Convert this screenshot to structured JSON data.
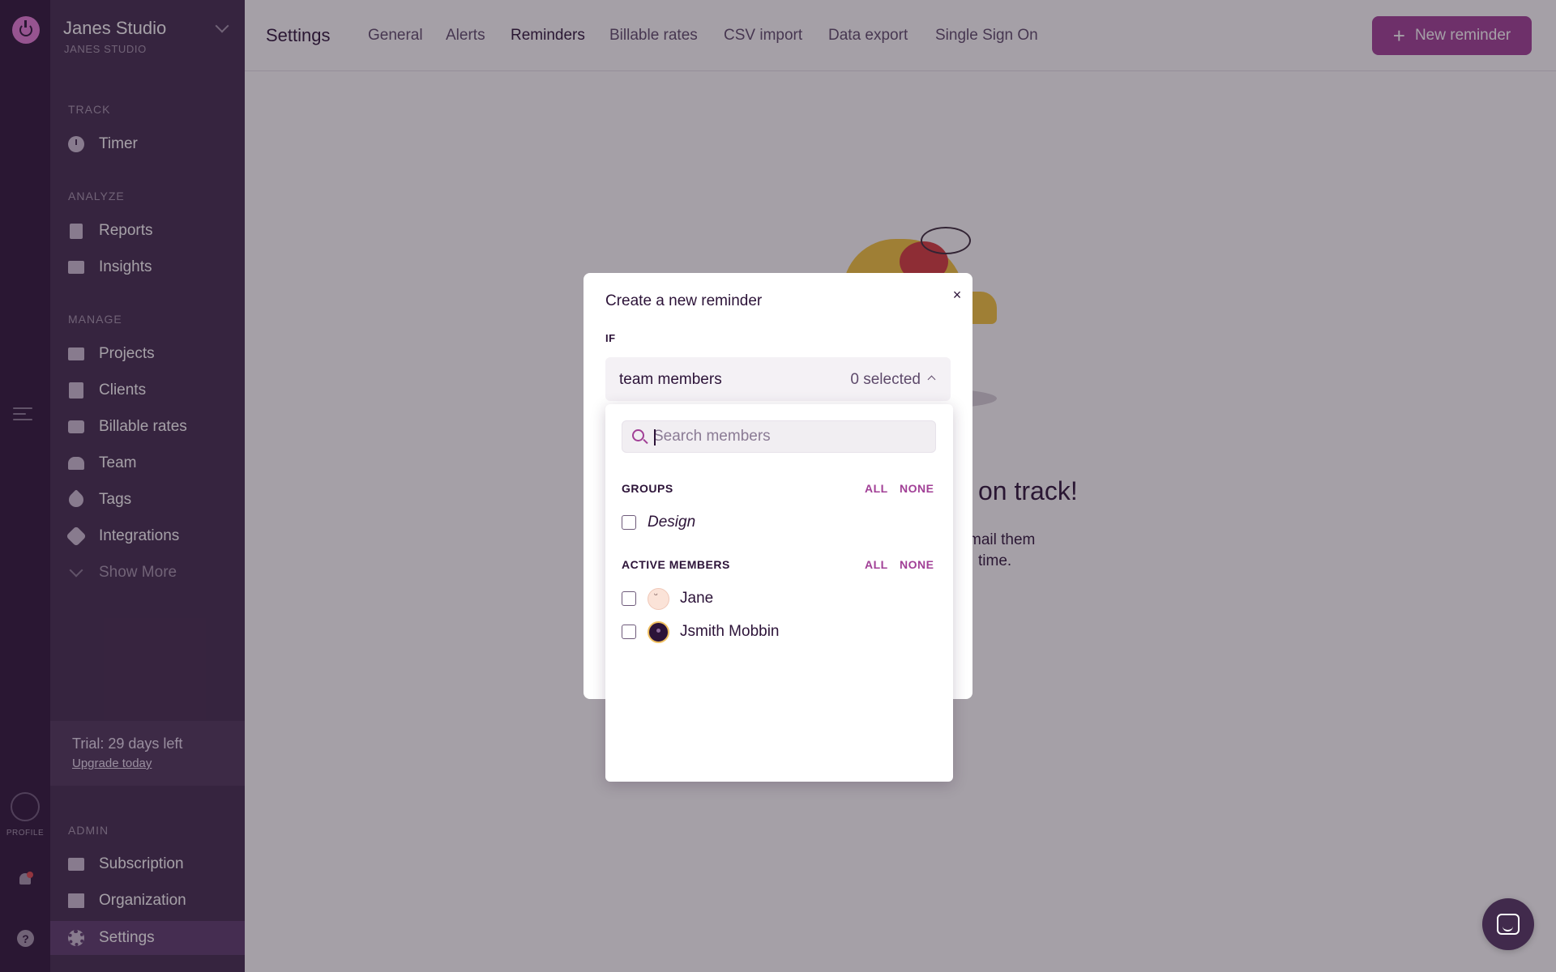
{
  "workspace": {
    "name": "Janes Studio",
    "subtitle": "JANES STUDIO"
  },
  "rail": {
    "profile_label": "PROFILE",
    "help": "?"
  },
  "sidebar": {
    "sections": {
      "track": "TRACK",
      "analyze": "ANALYZE",
      "manage": "MANAGE",
      "admin": "ADMIN"
    },
    "items": {
      "timer": "Timer",
      "reports": "Reports",
      "insights": "Insights",
      "projects": "Projects",
      "clients": "Clients",
      "billable_rates": "Billable rates",
      "team": "Team",
      "tags": "Tags",
      "integrations": "Integrations",
      "show_more": "Show More",
      "subscription": "Subscription",
      "organization": "Organization",
      "settings": "Settings"
    },
    "trial": {
      "text": "Trial: 29 days left",
      "link": "Upgrade today"
    }
  },
  "topbar": {
    "title": "Settings",
    "tabs": [
      "General",
      "Alerts",
      "Reminders",
      "Billable rates",
      "CSV import",
      "Data export",
      "Single Sign On"
    ],
    "active_tab": "Reminders",
    "new_button": "New reminder"
  },
  "background": {
    "heading": "on track!",
    "line1": "mail them",
    "line2": "time."
  },
  "modal": {
    "title": "Create a new reminder",
    "close": "×",
    "if_label": "IF",
    "select": {
      "label": "team members",
      "count": "0 selected"
    },
    "dropdown": {
      "search_placeholder": "Search members",
      "groups_label": "GROUPS",
      "active_label": "ACTIVE MEMBERS",
      "all": "ALL",
      "none": "NONE",
      "groups": [
        "Design"
      ],
      "members": [
        "Jane",
        "Jsmith Mobbin"
      ]
    }
  },
  "colors": {
    "accent": "#a13f96",
    "sidebar": "#412a4c",
    "rail": "#2c1338",
    "text": "#2c1338"
  }
}
